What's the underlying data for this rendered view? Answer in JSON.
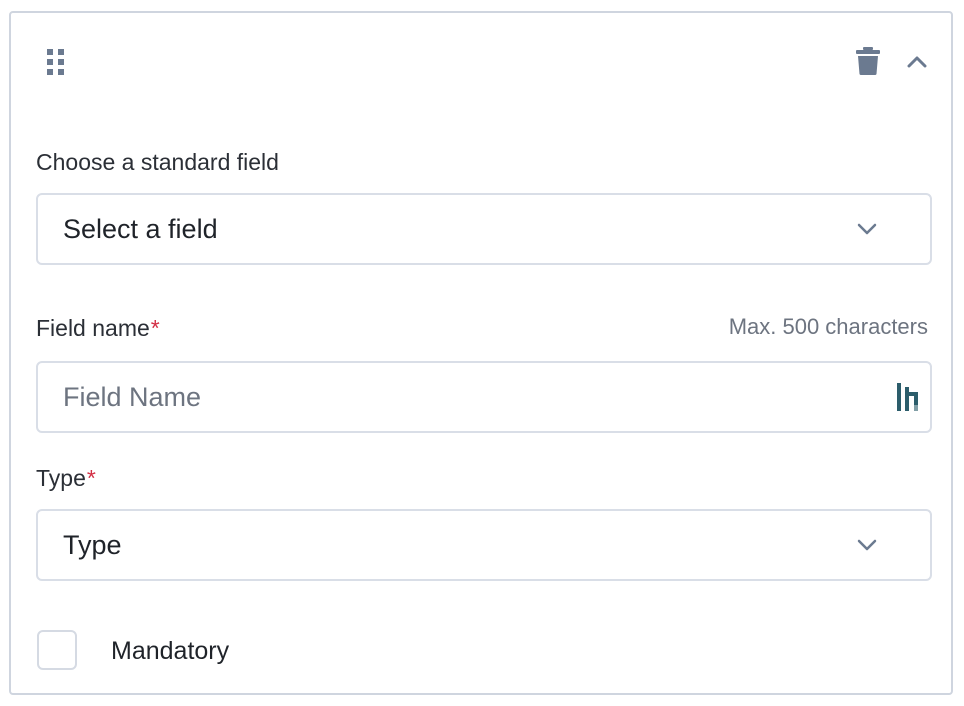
{
  "colors": {
    "icon": "#6b7a90",
    "required": "#d32f45",
    "border": "#d9dee7",
    "brand": "#2c5d6b"
  },
  "header": {
    "drag_icon": "drag-handle-icon",
    "delete_icon": "trash-icon",
    "collapse_icon": "chevron-up-icon"
  },
  "standard_field": {
    "label": "Choose a standard field",
    "selected": "Select a field"
  },
  "field_name": {
    "label": "Field name",
    "required_mark": "*",
    "hint": "Max. 500 characters",
    "placeholder": "Field Name",
    "value": ""
  },
  "type": {
    "label": "Type",
    "required_mark": "*",
    "selected": "Type"
  },
  "mandatory": {
    "label": "Mandatory",
    "checked": false
  }
}
